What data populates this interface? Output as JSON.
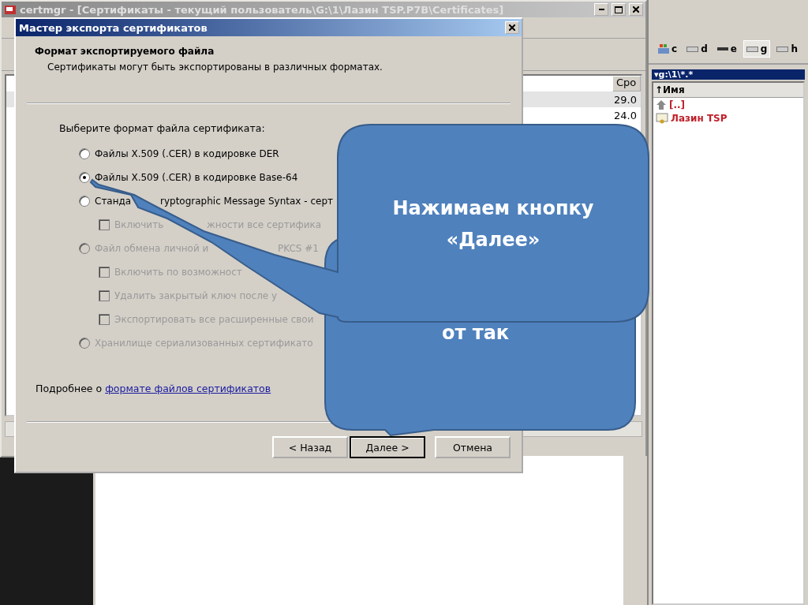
{
  "background_window": {
    "title": "certmgr - [Сертификаты - текущий пользователь\\G:\\1\\Лазин TSP.P7B\\Certificates]",
    "column_header": "Сро",
    "rows": [
      {
        "date": "29.0",
        "selected": true
      },
      {
        "date": "24.0",
        "selected": false
      }
    ]
  },
  "file_panel": {
    "drives": [
      {
        "label": "c",
        "selected": false
      },
      {
        "label": "d",
        "selected": false
      },
      {
        "label": "e",
        "selected": false
      },
      {
        "label": "g",
        "selected": true
      },
      {
        "label": "h",
        "selected": false
      }
    ],
    "path": "▾g:\\1\\*.*",
    "column_header": "↑Имя",
    "files": [
      {
        "name": "[..]",
        "kind": "up"
      },
      {
        "name": "Лазин TSP",
        "kind": "folder"
      }
    ]
  },
  "dialog": {
    "title": "Мастер экспорта сертификатов",
    "heading": "Формат экспортируемого файла",
    "subheading": "Сертификаты могут быть экспортированы в различных форматах.",
    "prompt": "Выберите формат файла сертификата:",
    "options": [
      {
        "kind": "radio",
        "label": "Файлы X.509 (.CER) в кодировке DER",
        "selected": false,
        "disabled": false
      },
      {
        "kind": "radio",
        "label": "Файлы X.509 (.CER) в кодировке Base-64",
        "selected": true,
        "disabled": false
      },
      {
        "kind": "radio",
        "label": "Станда",
        "label_tail": "ryptographic Message Syntax - серт",
        "selected": false,
        "disabled": false
      },
      {
        "kind": "checkbox",
        "label": "Включить",
        "label_tail": "жности все сертифика",
        "checked": false,
        "disabled": true
      },
      {
        "kind": "radio",
        "label": "Файл обмена личной и",
        "label_tail": "PKCS #1",
        "selected": false,
        "disabled": true
      },
      {
        "kind": "checkbox",
        "label": "Включить по возможност",
        "checked": false,
        "disabled": true
      },
      {
        "kind": "checkbox",
        "label": "Удалить закрытый ключ после у",
        "checked": false,
        "disabled": true
      },
      {
        "kind": "checkbox",
        "label": "Экспортировать все расширенные свои",
        "checked": false,
        "disabled": true
      },
      {
        "kind": "radio",
        "label": "Хранилище сериализованных сертификато",
        "selected": false,
        "disabled": true
      }
    ],
    "more_text": "Подробнее о",
    "more_link": "формате файлов сертификатов",
    "buttons": [
      {
        "label": "< Назад",
        "default": false
      },
      {
        "label": "Далее >",
        "default": true
      },
      {
        "label": "Отмена",
        "default": false
      }
    ]
  },
  "callouts": [
    {
      "text": "Нажимаем кнопку «Далее»"
    },
    {
      "text": "от так"
    }
  ]
}
